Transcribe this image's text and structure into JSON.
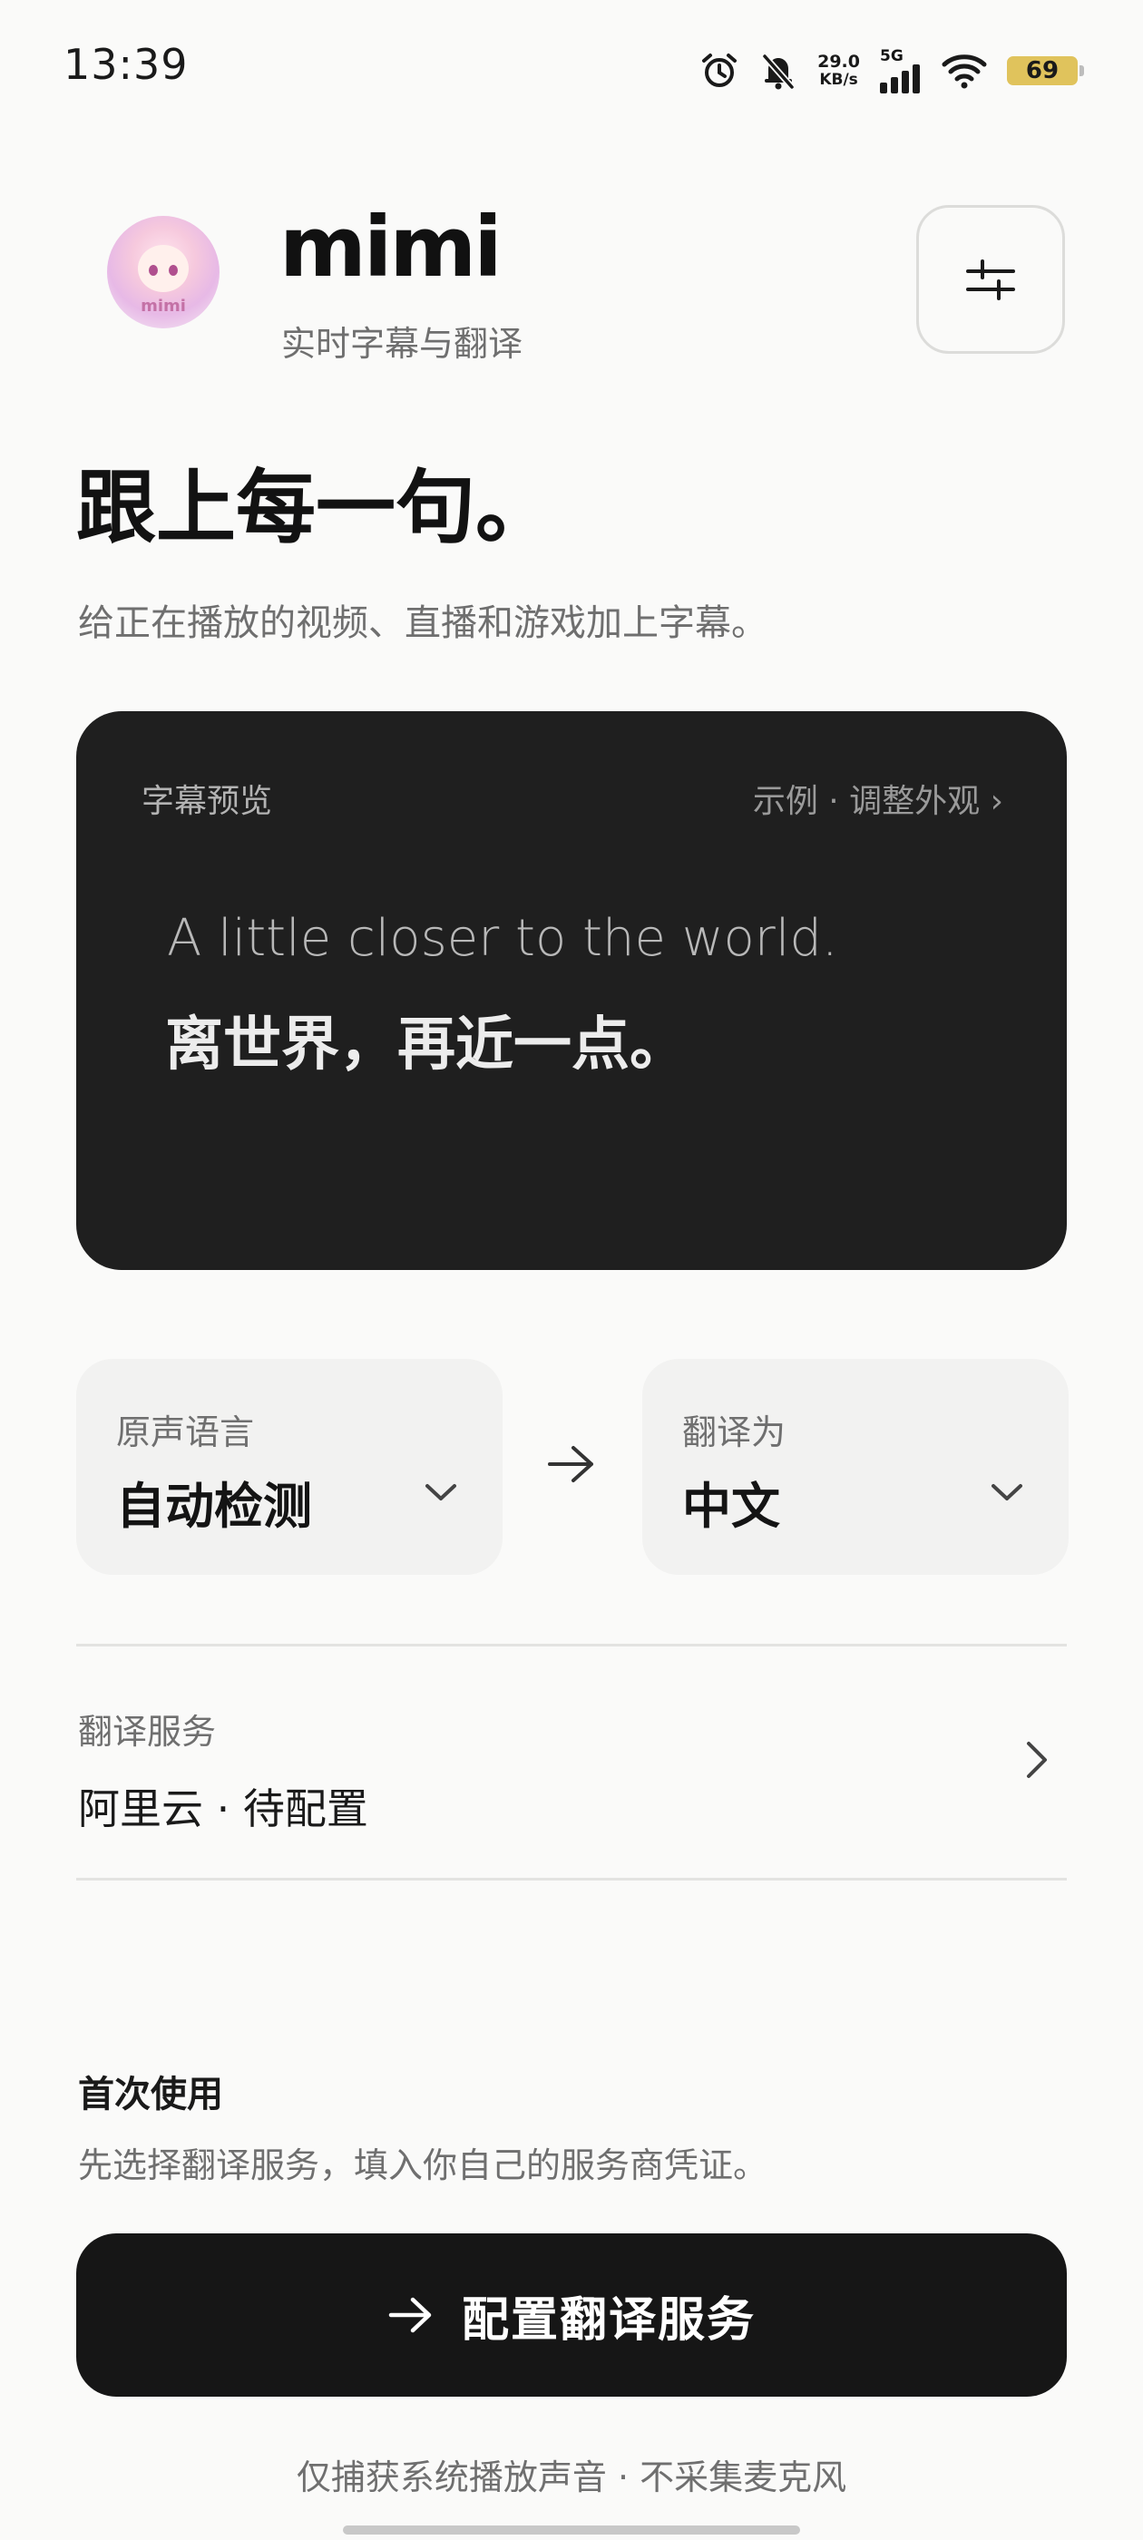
{
  "status_bar": {
    "time": "13:39",
    "net_speed_value": "29.0",
    "net_speed_unit": "KB/s",
    "network_type": "5G",
    "battery_level": "69",
    "icons": [
      "alarm-icon",
      "bell-muted-icon",
      "signal-icon",
      "wifi-icon",
      "battery-icon"
    ]
  },
  "header": {
    "avatar_text": "mimi",
    "app_name": "mimi",
    "subtitle": "实时字幕与翻译",
    "settings_icon": "sliders-icon"
  },
  "hero": {
    "headline": "跟上每一句。",
    "tagline": "给正在播放的视频、直播和游戏加上字幕。"
  },
  "preview": {
    "label": "字幕预览",
    "link": "示例 · 调整外观 ›",
    "sample_original": "A little closer to the world.",
    "sample_translation": "离世界，再近一点。"
  },
  "languages": {
    "source_label": "原声语言",
    "source_value": "自动检测",
    "target_label": "翻译为",
    "target_value": "中文"
  },
  "service": {
    "label": "翻译服务",
    "value": "阿里云 · 待配置"
  },
  "onboarding": {
    "title": "首次使用",
    "description": "先选择翻译服务，填入你自己的服务商凭证。",
    "button_label": "配置翻译服务"
  },
  "footer": {
    "note": "仅捕获系统播放声音 · 不采集麦克风"
  },
  "colors": {
    "background": "#fafaf9",
    "card_dark": "#1f1f1f",
    "cta": "#161616",
    "battery": "#e0c35c"
  }
}
